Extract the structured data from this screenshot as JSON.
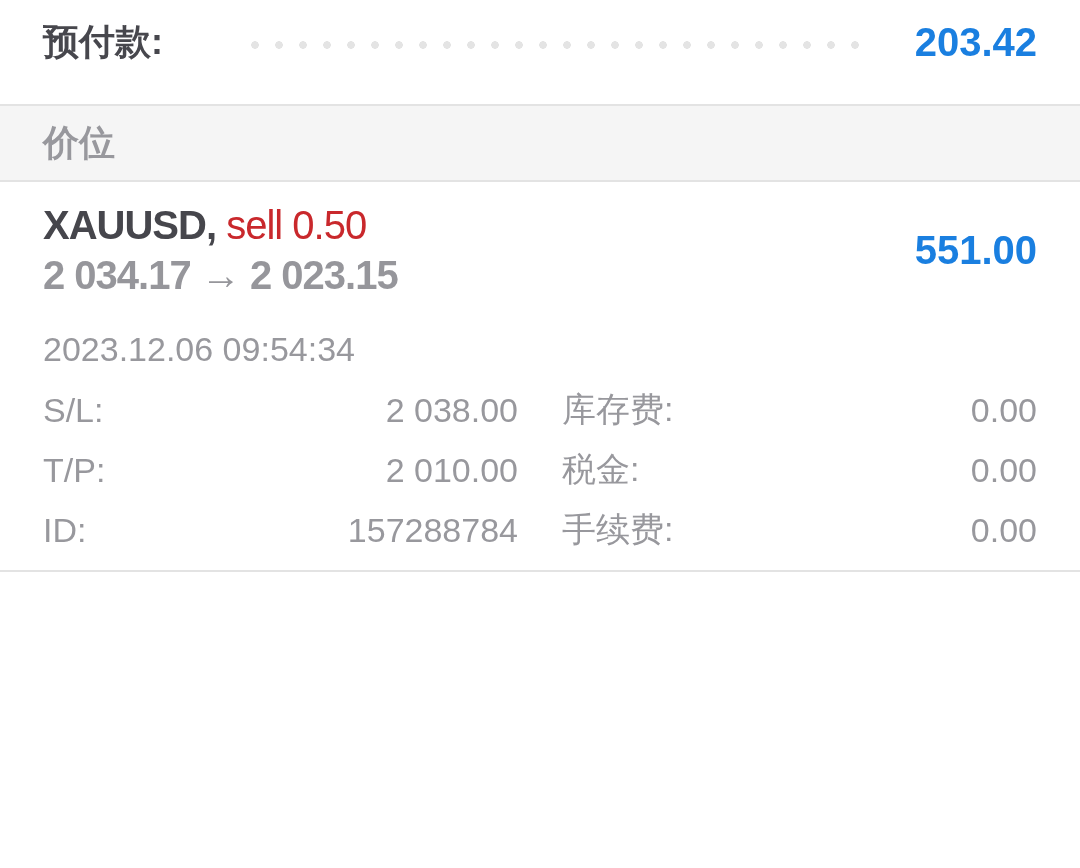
{
  "margin_row": {
    "label": "预付款:",
    "value": "203.42"
  },
  "section": {
    "title": "价位"
  },
  "positions": [
    {
      "symbol": "XAUUSD,",
      "order": "sell 0.50",
      "open_price": "2 034.17",
      "arrow": "→",
      "current_price": "2 023.15",
      "profit": "551.00",
      "time": "2023.12.06 09:54:34",
      "details": [
        {
          "label": "S/L:",
          "value": "2 038.00"
        },
        {
          "label": "库存费:",
          "value": "0.00"
        },
        {
          "label": "T/P:",
          "value": "2 010.00"
        },
        {
          "label": "税金:",
          "value": "0.00"
        },
        {
          "label": "ID:",
          "value": "157288784"
        },
        {
          "label": "手续费:",
          "value": "0.00"
        }
      ]
    }
  ]
}
